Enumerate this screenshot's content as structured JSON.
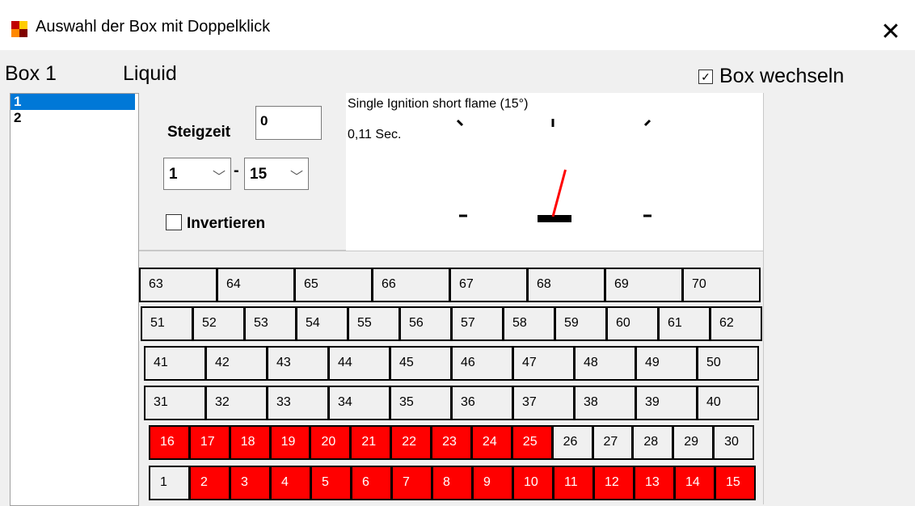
{
  "window": {
    "title": "Auswahl der Box mit Doppelklick",
    "close_icon": "close-icon",
    "app_icon": "app-icon"
  },
  "header": {
    "box_label": "Box 1",
    "box_type": "Liquid",
    "switch_label": "Box wechseln",
    "switch_checked": true
  },
  "box_list": {
    "items": [
      "1",
      "2"
    ],
    "selected": "1"
  },
  "controls": {
    "rise_time_label": "Steigzeit",
    "rise_time_value": "0",
    "range_from": "1",
    "range_to": "15",
    "range_separator": "-",
    "invert_label": "Invertieren",
    "invert_checked": false
  },
  "preview": {
    "title": "Single Ignition short flame (15°)",
    "duration": "0,11 Sec.",
    "angle_deg": 15
  },
  "colors": {
    "fired": "#ff0000",
    "selection": "#0078d7",
    "needle": "#ff0000"
  },
  "grid": {
    "rows": [
      [
        "63",
        "64",
        "65",
        "66",
        "67",
        "68",
        "69",
        "70"
      ],
      [
        "51",
        "52",
        "53",
        "54",
        "55",
        "56",
        "57",
        "58",
        "59",
        "60",
        "61",
        "62"
      ],
      [
        "41",
        "42",
        "43",
        "44",
        "45",
        "46",
        "47",
        "48",
        "49",
        "50"
      ],
      [
        "31",
        "32",
        "33",
        "34",
        "35",
        "36",
        "37",
        "38",
        "39",
        "40"
      ],
      [
        "16",
        "17",
        "18",
        "19",
        "20",
        "21",
        "22",
        "23",
        "24",
        "25",
        "26",
        "27",
        "28",
        "29",
        "30"
      ],
      [
        "1",
        "2",
        "3",
        "4",
        "5",
        "6",
        "7",
        "8",
        "9",
        "10",
        "11",
        "12",
        "13",
        "14",
        "15"
      ]
    ],
    "fired": [
      "2",
      "3",
      "4",
      "5",
      "6",
      "7",
      "8",
      "9",
      "10",
      "11",
      "12",
      "13",
      "14",
      "15",
      "16",
      "17",
      "18",
      "19",
      "20",
      "21",
      "22",
      "23",
      "24",
      "25"
    ]
  }
}
